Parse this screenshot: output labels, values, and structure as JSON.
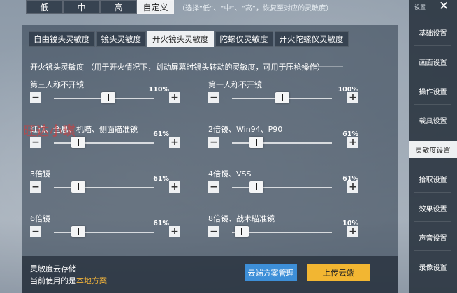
{
  "presets": {
    "buttons": [
      "低",
      "中",
      "高",
      "自定义"
    ],
    "selected": "自定义",
    "hint": "（选择“低”、“中”、“高”，恢复至对应的灵敏度）"
  },
  "tabs": [
    "自由镜头灵敏度",
    "镜头灵敏度",
    "开火镜头灵敏度",
    "陀螺仪灵敏度",
    "开火陀螺仪灵敏度"
  ],
  "active_tab": "开火镜头灵敏度",
  "section": {
    "title": "开火镜头灵敏度  （用于开火情况下，划动屏幕时镜头转动的灵敏度，可用于压枪操作）"
  },
  "sliders": [
    {
      "label": "第三人称不开镜",
      "value": "110%",
      "level": 0.55
    },
    {
      "label": "第一人称不开镜",
      "value": "100%",
      "level": 0.5
    },
    {
      "label": "红点、全息、机瞄、侧面瞄准镜",
      "value": "61%",
      "level": 0.2
    },
    {
      "label": "2倍镜、Win94、P90",
      "value": "61%",
      "level": 0.2
    },
    {
      "label": "3倍镜",
      "value": "61%",
      "level": 0.2
    },
    {
      "label": "4倍镜、VSS",
      "value": "61%",
      "level": 0.2
    },
    {
      "label": "6倍镜",
      "value": "61%",
      "level": 0.2
    },
    {
      "label": "8倍镜、战术瞄准镜",
      "value": "10%",
      "level": 0.03
    }
  ],
  "stepper": {
    "minus": "−",
    "plus": "+"
  },
  "cloud": {
    "title": "灵敏度云存储",
    "current_prefix": "当前使用的是",
    "current_value": "本地方案",
    "manage_label": "云端方案管理",
    "upload_label": "上传云端"
  },
  "sidebar": {
    "title": "设置",
    "close": "✕",
    "items": [
      "基础设置",
      "画面设置",
      "操作设置",
      "载具设置",
      "灵敏度设置",
      "拾取设置",
      "效果设置",
      "声音设置",
      "录像设置"
    ],
    "active": "灵敏度设置"
  },
  "watermark": "旺达小琪",
  "colors": {
    "accent_blue": "#3d8fd8",
    "accent_yellow": "#f2b632",
    "highlight": "#f3b43a"
  }
}
